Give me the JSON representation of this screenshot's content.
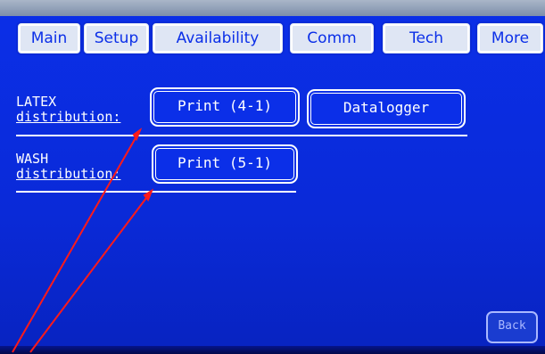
{
  "tabs": [
    {
      "label": "Main"
    },
    {
      "label": "Setup"
    },
    {
      "label": "Availability"
    },
    {
      "label": "Comm"
    },
    {
      "label": "Tech"
    },
    {
      "label": "More"
    }
  ],
  "rows": [
    {
      "label_line1": "LATEX",
      "label_line2": "distribution:",
      "buttons": [
        {
          "label": "Print (4-1)"
        },
        {
          "label": "Datalogger"
        }
      ]
    },
    {
      "label_line1": "WASH",
      "label_line2": "distribution:",
      "buttons": [
        {
          "label": "Print (5-1)"
        }
      ]
    }
  ],
  "footer": {
    "back_label": "Back"
  },
  "colors": {
    "screen": "#0b2fe8",
    "tab_bg": "#ffffff",
    "text": "#ffffff",
    "annotation_arrow": "#ff1a1a"
  }
}
